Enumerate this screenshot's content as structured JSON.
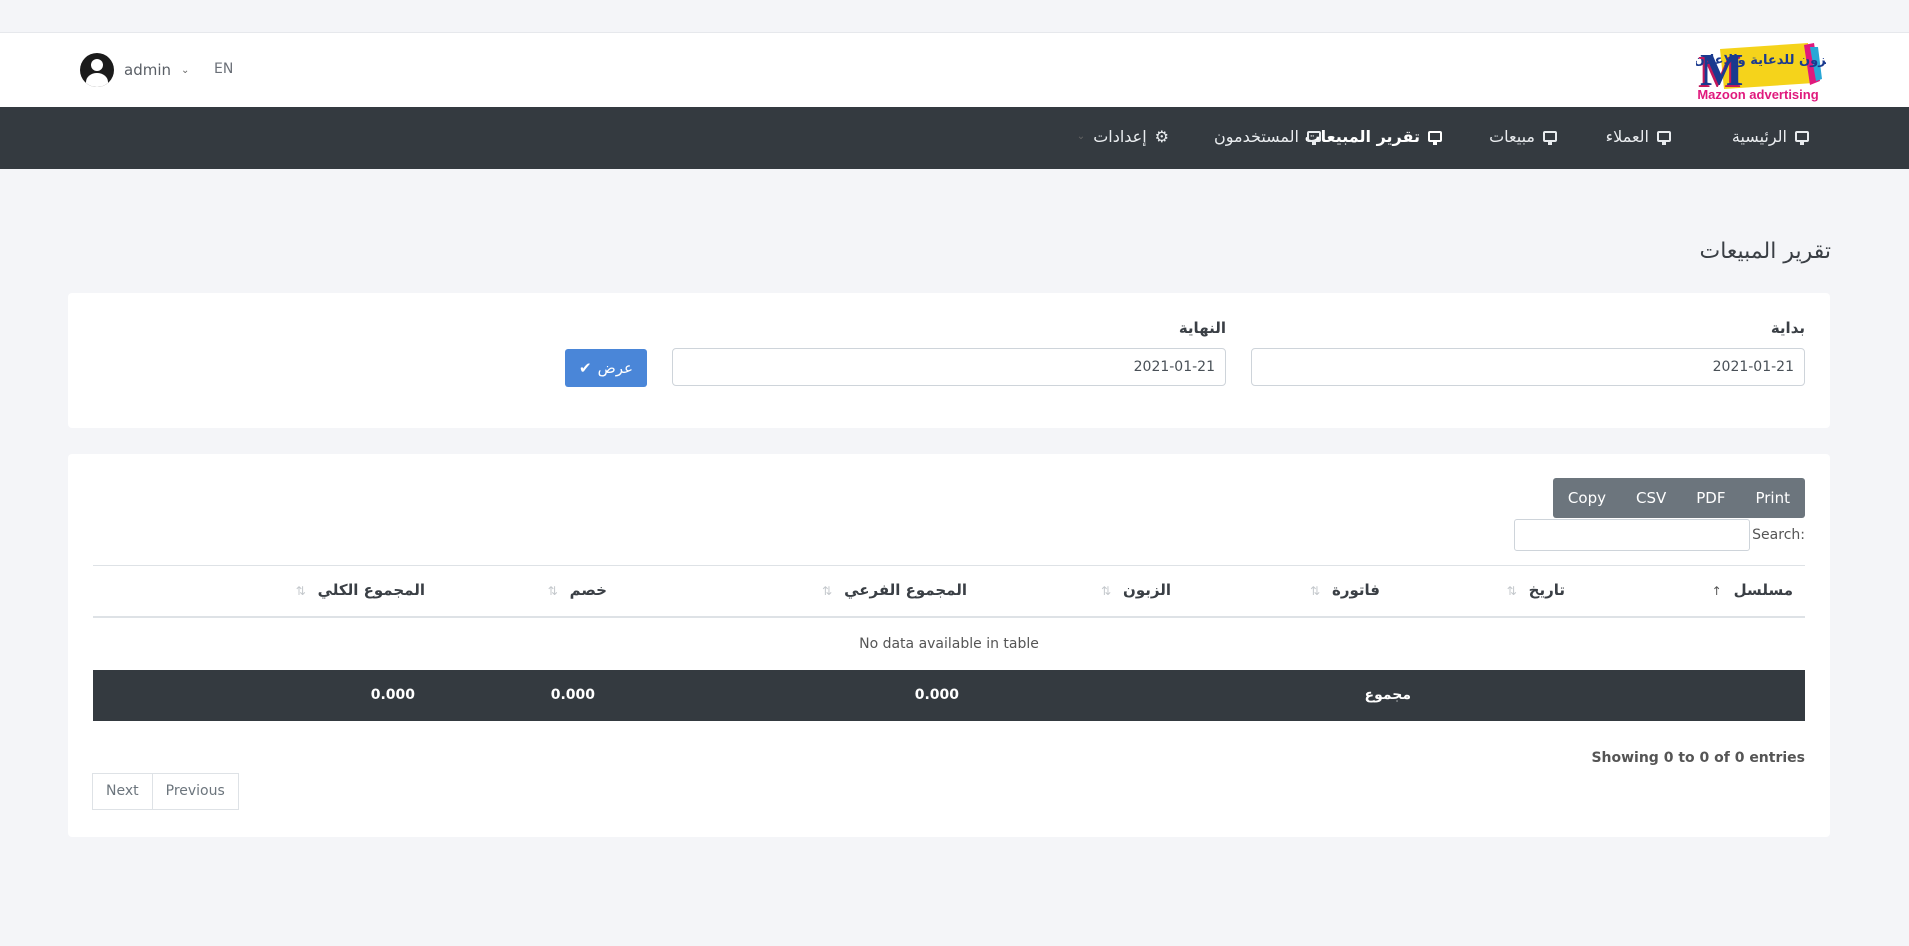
{
  "header": {
    "logo_text_ar": "مزون للدعاية والإعلان",
    "logo_text_en": "Mazoon advertising",
    "user_name": "admin",
    "language": "EN"
  },
  "nav": {
    "items": [
      {
        "label": "الرئيسية"
      },
      {
        "label": "العملاء"
      },
      {
        "label": "مبيعات"
      },
      {
        "label": "تقرير المبيعات"
      },
      {
        "label": "المستخدمون"
      },
      {
        "label": "إعدادات"
      }
    ]
  },
  "page": {
    "title": "تقرير المبيعات"
  },
  "filter": {
    "start_label": "بداية",
    "start_value": "2021-01-21",
    "end_label": "النهاية",
    "end_value": "2021-01-21",
    "submit_label": "عرض"
  },
  "table": {
    "buttons": {
      "copy": "Copy",
      "csv": "CSV",
      "pdf": "PDF",
      "print": "Print"
    },
    "search_label": "Search:",
    "columns": [
      "مسلسل",
      "تاريخ",
      "فاتورة",
      "الزبون",
      "المجموع الفرعي",
      "خصم",
      "المجموع الكلي"
    ],
    "empty_text": "No data available in table",
    "footer": {
      "label": "مجموع",
      "subtotal": "0.000",
      "discount": "0.000",
      "total": "0.000"
    },
    "info": "Showing 0 to 0 of 0 entries",
    "pagination": {
      "previous": "Previous",
      "next": "Next"
    }
  },
  "colors": {
    "navbar": "#343a40",
    "primary_button": "#4a86d8",
    "button_group": "#6c757d",
    "logo_yellow": "#f5d31b",
    "logo_pink": "#e0197d"
  }
}
